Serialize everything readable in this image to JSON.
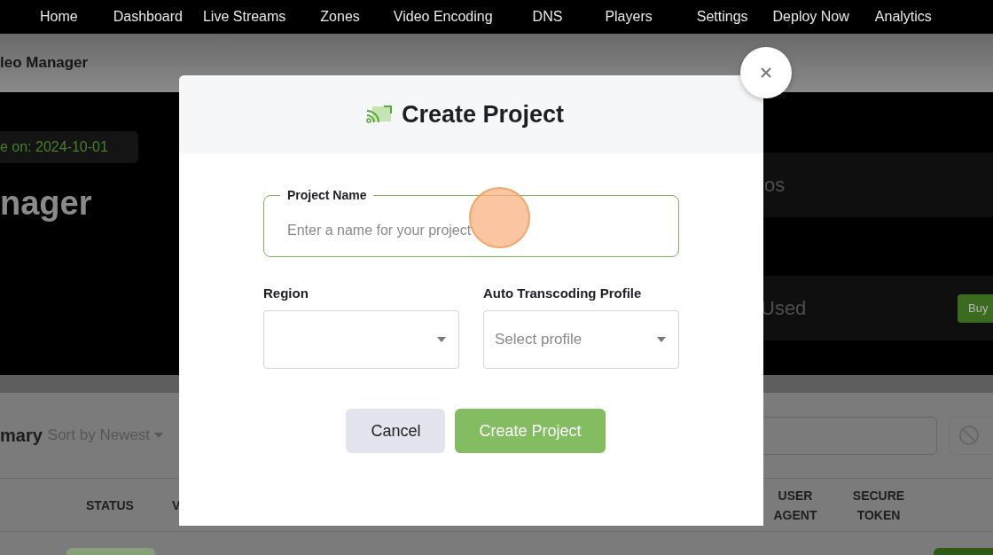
{
  "nav": {
    "items": [
      "Home",
      "Dashboard",
      "Live Streams",
      "Zones",
      "Video Encoding",
      "DNS",
      "Players",
      "Settings",
      "Deploy Now",
      "Analytics"
    ]
  },
  "page_header": {
    "title": "leo Manager"
  },
  "hero": {
    "date_badge": "e on: 2024-10-01",
    "title": "nager",
    "cards": [
      {
        "text": "os"
      },
      {
        "text": "Used",
        "button": "Buy"
      }
    ]
  },
  "summary": {
    "title": "mary",
    "sort": "Sort by Newest"
  },
  "table": {
    "columns": [
      "STATUS",
      "V",
      "USER AGENT",
      "SECURE TOKEN"
    ]
  },
  "modal": {
    "title": "Create Project",
    "fields": [
      {
        "kind": "text",
        "label": "Project Name",
        "placeholder": "Enter a name for your project"
      },
      {
        "kind": "select",
        "label": "Region"
      },
      {
        "kind": "select",
        "label": "Auto Transcoding Profile",
        "placeholder": "Select profile"
      }
    ],
    "buttons": [
      {
        "kind": "secondary",
        "label": "Cancel"
      },
      {
        "kind": "primary",
        "label": "Create Project"
      }
    ]
  }
}
